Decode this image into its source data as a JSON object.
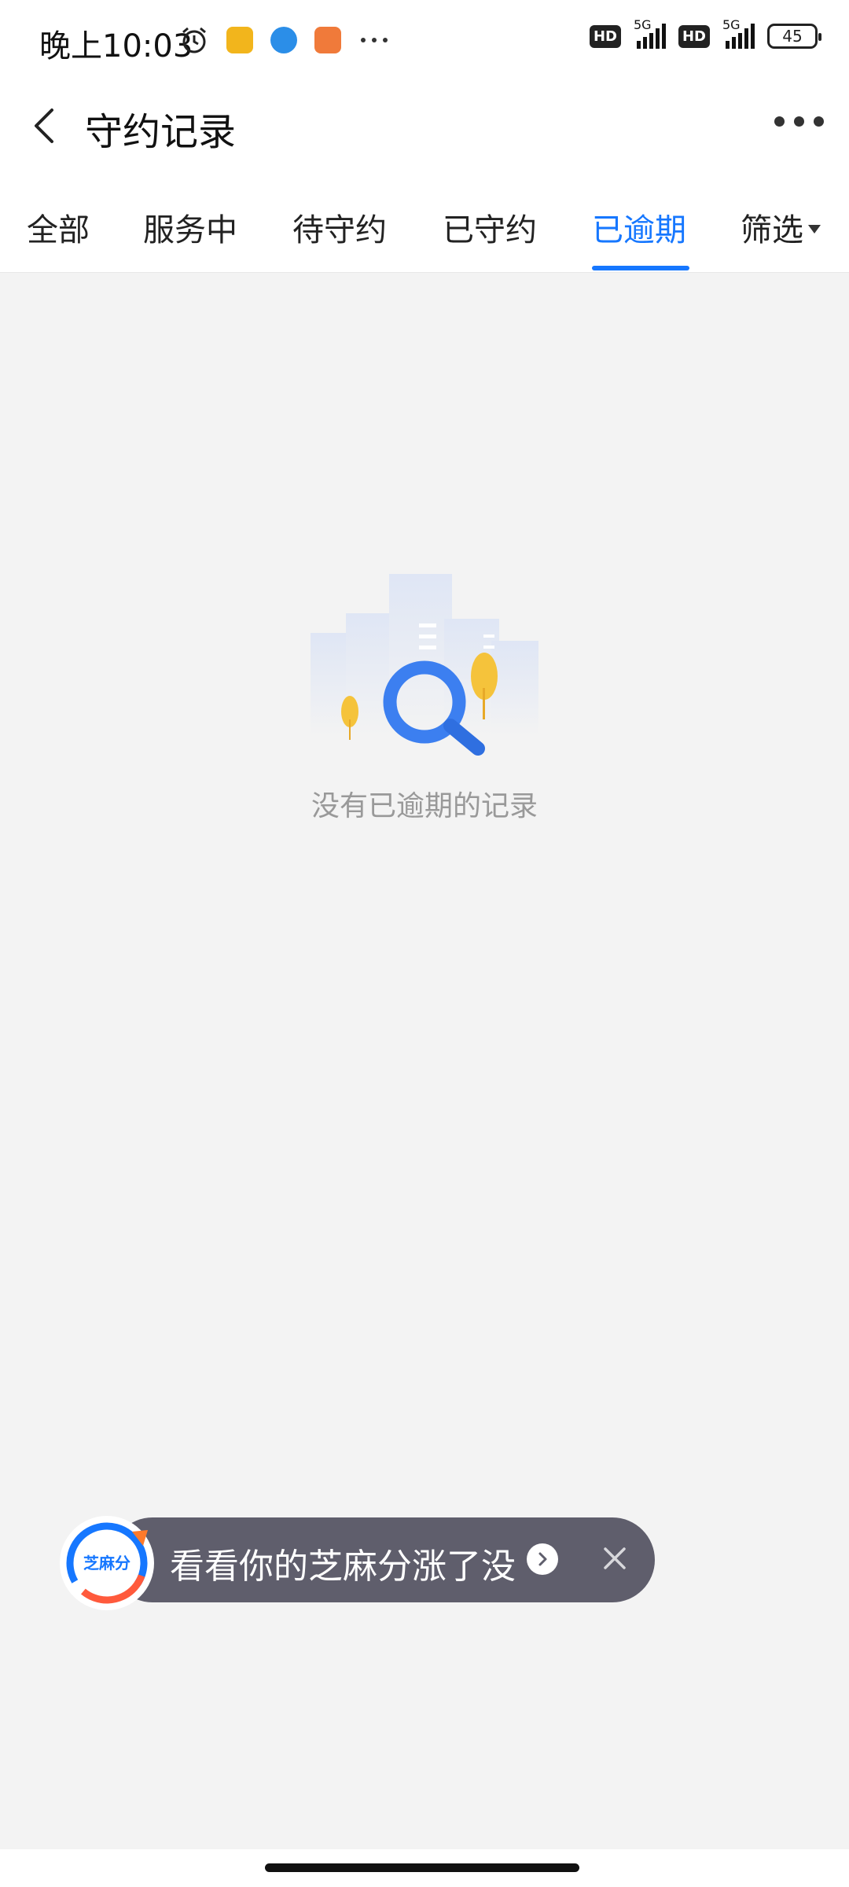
{
  "status_bar": {
    "time": "晚上10:03",
    "hd1": "HD",
    "hd2": "HD",
    "net1": "5G",
    "net2": "5G",
    "battery": "45",
    "icons": [
      "alarm-icon",
      "app-icon-yellow",
      "app-icon-blue",
      "app-icon-orange",
      "more-notifications-icon"
    ]
  },
  "nav": {
    "title": "守约记录"
  },
  "tabs": {
    "items": [
      "全部",
      "服务中",
      "待守约",
      "已守约",
      "已逾期"
    ],
    "active_index": 4,
    "filter_label": "筛选"
  },
  "empty_state": {
    "message": "没有已逾期的记录"
  },
  "promo": {
    "logo_text": "芝麻分",
    "text": "看看你的芝麻分涨了没"
  },
  "colors": {
    "accent": "#1677ff",
    "background": "#f3f3f3",
    "promo_bg": "#5f5e6c"
  }
}
